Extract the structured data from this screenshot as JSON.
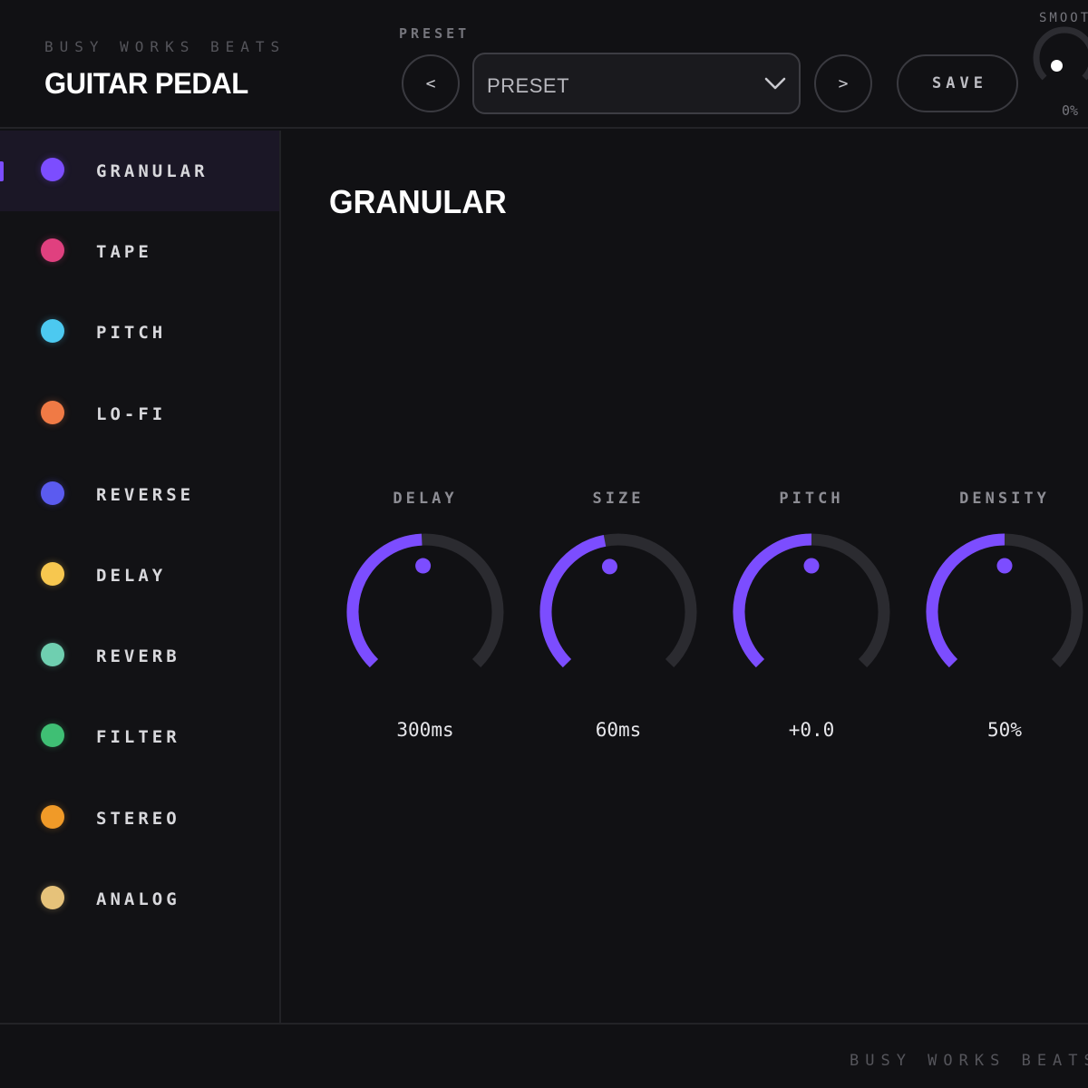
{
  "header": {
    "brand": "BUSY WORKS BEATS",
    "title": "GUITAR PEDAL",
    "preset_label": "PRESET",
    "prev_label": "<",
    "next_label": ">",
    "preset_value": "PRESET",
    "save_label": "SAVE",
    "smooth_label": "SMOOTH",
    "smooth_value": "0%",
    "smooth_level": 0
  },
  "sidebar": {
    "active_index": 0,
    "items": [
      {
        "label": "GRANULAR",
        "color": "#7c4dff"
      },
      {
        "label": "TAPE",
        "color": "#e0407f"
      },
      {
        "label": "PITCH",
        "color": "#4cc9f0"
      },
      {
        "label": "LO-FI",
        "color": "#f07a45"
      },
      {
        "label": "REVERSE",
        "color": "#5b5bf0"
      },
      {
        "label": "DELAY",
        "color": "#f7c74f"
      },
      {
        "label": "REVERB",
        "color": "#6fcfb0"
      },
      {
        "label": "FILTER",
        "color": "#3fbf74"
      },
      {
        "label": "STEREO",
        "color": "#f09a28"
      },
      {
        "label": "ANALOG",
        "color": "#e6c27a"
      }
    ]
  },
  "main": {
    "title": "GRANULAR",
    "accent_color": "#7c4dff",
    "knobs": [
      {
        "label": "DELAY",
        "value": "300ms",
        "level": 0.49
      },
      {
        "label": "SIZE",
        "value": "60ms",
        "level": 0.46
      },
      {
        "label": "PITCH",
        "value": "+0.0",
        "level": 0.5
      },
      {
        "label": "DENSITY",
        "value": "50%",
        "level": 0.5
      }
    ]
  },
  "footer": {
    "brand": "BUSY WORKS BEATS"
  }
}
